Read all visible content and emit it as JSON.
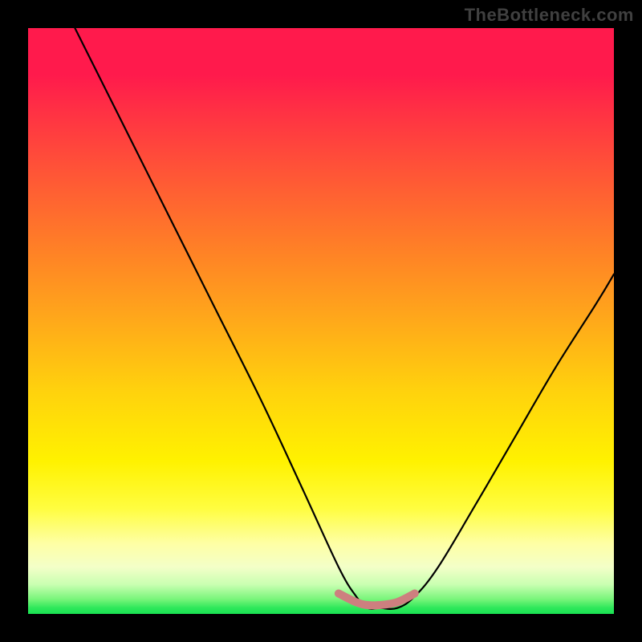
{
  "watermark": "TheBottleneck.com",
  "chart_data": {
    "type": "line",
    "title": "",
    "xlabel": "",
    "ylabel": "",
    "x_range": [
      0,
      100
    ],
    "y_range": [
      0,
      100
    ],
    "background_gradient_stops": [
      {
        "pos": 0,
        "color": "#ff1a4c"
      },
      {
        "pos": 50,
        "color": "#ffa91a"
      },
      {
        "pos": 82,
        "color": "#fffd40"
      },
      {
        "pos": 100,
        "color": "#19e252"
      }
    ],
    "series": [
      {
        "name": "main-curve",
        "color": "#000000",
        "x": [
          8,
          12,
          18,
          25,
          32,
          40,
          47,
          53,
          56,
          58,
          60,
          63,
          66,
          70,
          76,
          83,
          90,
          97,
          100
        ],
        "y": [
          100,
          92,
          80,
          66,
          52,
          36,
          21,
          8,
          3,
          1,
          1,
          1,
          3,
          8,
          18,
          30,
          42,
          53,
          58
        ]
      },
      {
        "name": "highlight-band",
        "color": "#d98080",
        "note": "flat segment near valley bottom",
        "x": [
          53,
          56,
          58,
          60,
          63,
          66
        ],
        "y": [
          3.5,
          2,
          1.5,
          1.5,
          2,
          3.5
        ]
      }
    ]
  }
}
